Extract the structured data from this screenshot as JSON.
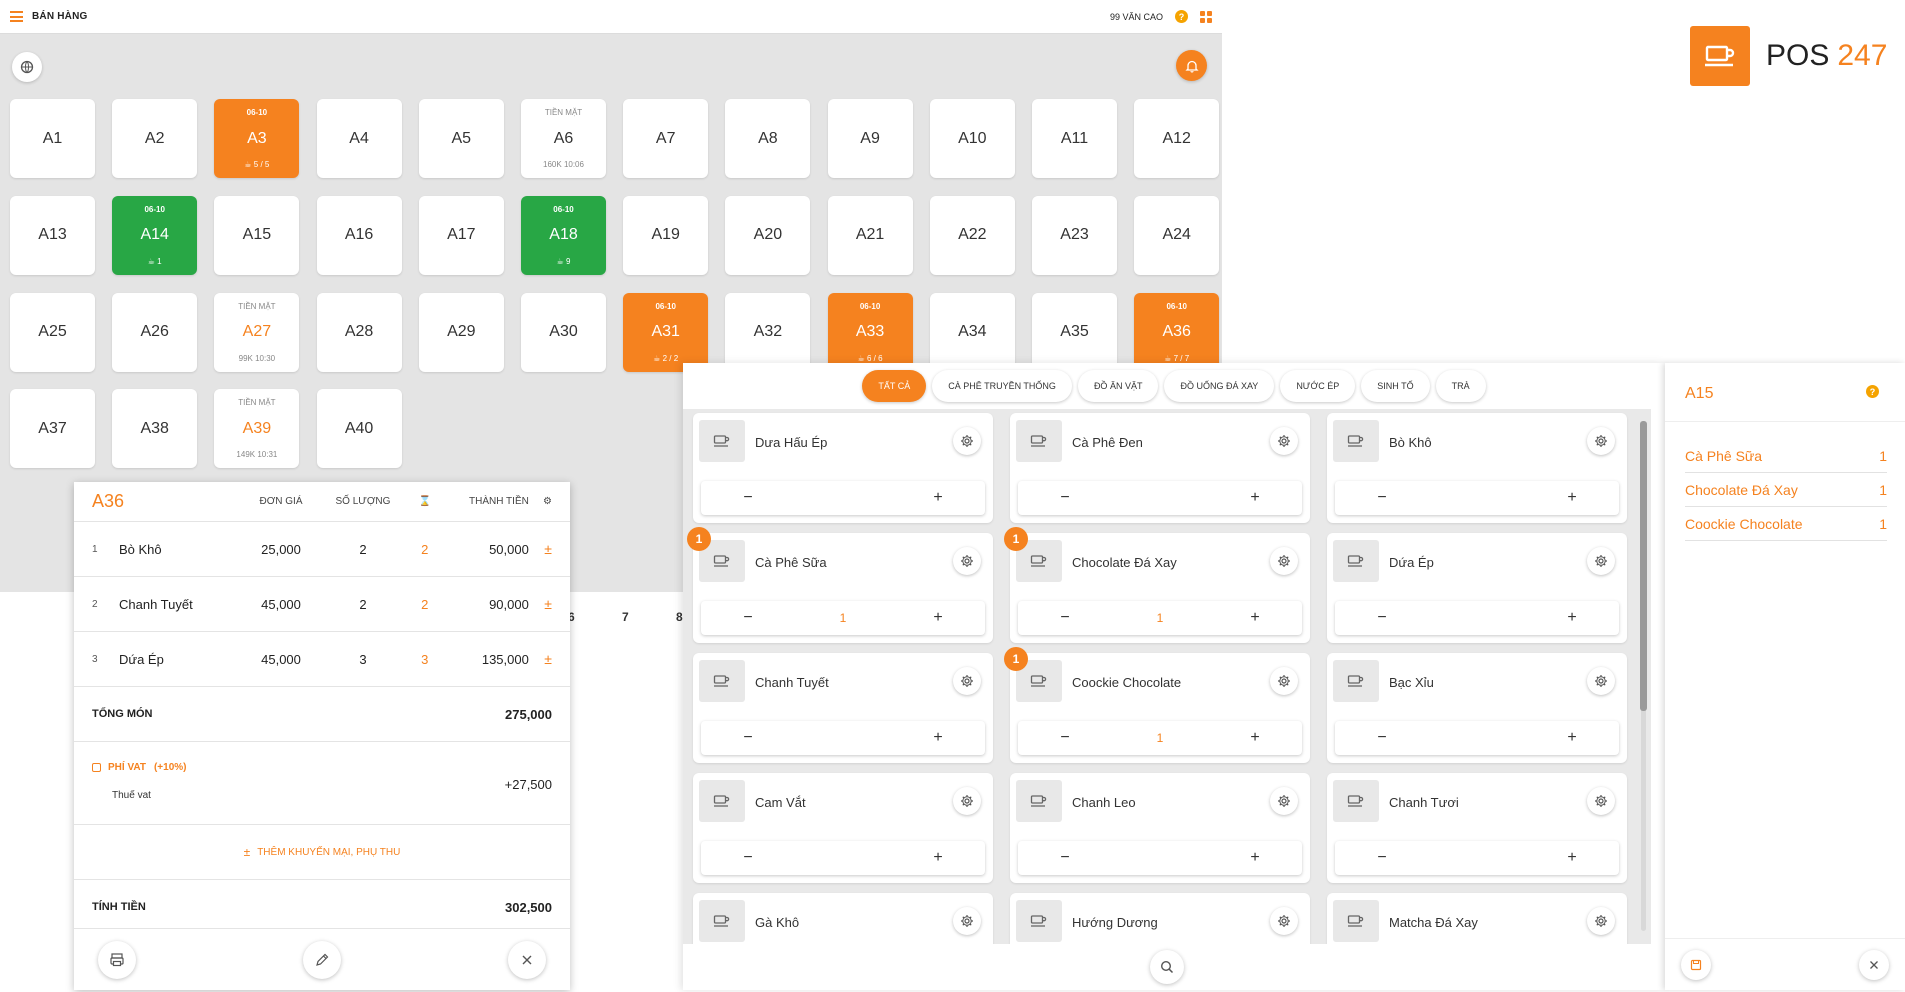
{
  "header": {
    "title": "BÁN HÀNG",
    "store": "99 VĂN CAO",
    "help": "?"
  },
  "tables": [
    {
      "name": "A1",
      "style": "plain",
      "top": "",
      "bottom": ""
    },
    {
      "name": "A2",
      "style": "plain",
      "top": "",
      "bottom": ""
    },
    {
      "name": "A3",
      "style": "orange",
      "top": "06-10",
      "bottom": "5 / 5"
    },
    {
      "name": "A4",
      "style": "plain",
      "top": "",
      "bottom": ""
    },
    {
      "name": "A5",
      "style": "plain",
      "top": "",
      "bottom": ""
    },
    {
      "name": "A6",
      "style": "plain",
      "top": "TIỀN MẶT",
      "bottom": "160K 10:06"
    },
    {
      "name": "A7",
      "style": "plain",
      "top": "",
      "bottom": ""
    },
    {
      "name": "A8",
      "style": "plain",
      "top": "",
      "bottom": ""
    },
    {
      "name": "A9",
      "style": "plain",
      "top": "",
      "bottom": ""
    },
    {
      "name": "A10",
      "style": "plain",
      "top": "",
      "bottom": ""
    },
    {
      "name": "A11",
      "style": "plain",
      "top": "",
      "bottom": ""
    },
    {
      "name": "A12",
      "style": "plain",
      "top": "",
      "bottom": ""
    },
    {
      "name": "A13",
      "style": "plain",
      "top": "",
      "bottom": ""
    },
    {
      "name": "A14",
      "style": "green",
      "top": "06-10",
      "bottom": "1"
    },
    {
      "name": "A15",
      "style": "plain",
      "top": "",
      "bottom": ""
    },
    {
      "name": "A16",
      "style": "plain",
      "top": "",
      "bottom": ""
    },
    {
      "name": "A17",
      "style": "plain",
      "top": "",
      "bottom": ""
    },
    {
      "name": "A18",
      "style": "green",
      "top": "06-10",
      "bottom": "9"
    },
    {
      "name": "A19",
      "style": "plain",
      "top": "",
      "bottom": ""
    },
    {
      "name": "A20",
      "style": "plain",
      "top": "",
      "bottom": ""
    },
    {
      "name": "A21",
      "style": "plain",
      "top": "",
      "bottom": ""
    },
    {
      "name": "A22",
      "style": "plain",
      "top": "",
      "bottom": ""
    },
    {
      "name": "A23",
      "style": "plain",
      "top": "",
      "bottom": ""
    },
    {
      "name": "A24",
      "style": "plain",
      "top": "",
      "bottom": ""
    },
    {
      "name": "A25",
      "style": "plain",
      "top": "",
      "bottom": ""
    },
    {
      "name": "A26",
      "style": "plain",
      "top": "",
      "bottom": ""
    },
    {
      "name": "A27",
      "style": "cash",
      "top": "TIỀN MẶT",
      "bottom": "99K 10:30"
    },
    {
      "name": "A28",
      "style": "plain",
      "top": "",
      "bottom": ""
    },
    {
      "name": "A29",
      "style": "plain",
      "top": "",
      "bottom": ""
    },
    {
      "name": "A30",
      "style": "plain",
      "top": "",
      "bottom": ""
    },
    {
      "name": "A31",
      "style": "orange",
      "top": "06-10",
      "bottom": "2 / 2"
    },
    {
      "name": "A32",
      "style": "plain",
      "top": "",
      "bottom": ""
    },
    {
      "name": "A33",
      "style": "orange",
      "top": "06-10",
      "bottom": "6 / 6"
    },
    {
      "name": "A34",
      "style": "plain",
      "top": "",
      "bottom": ""
    },
    {
      "name": "A35",
      "style": "plain",
      "top": "",
      "bottom": ""
    },
    {
      "name": "A36",
      "style": "orange",
      "top": "06-10",
      "bottom": "7 / 7"
    },
    {
      "name": "A37",
      "style": "plain",
      "top": "",
      "bottom": ""
    },
    {
      "name": "A38",
      "style": "plain",
      "top": "",
      "bottom": ""
    },
    {
      "name": "A39",
      "style": "cash",
      "top": "TIỀN MẶT",
      "bottom": "149K 10:31"
    },
    {
      "name": "A40",
      "style": "plain",
      "top": "",
      "bottom": ""
    }
  ],
  "stray_numbers": {
    "six": "6",
    "seven": "7",
    "eight": "8"
  },
  "order": {
    "table": "A36",
    "headers": {
      "price": "ĐƠN GIÁ",
      "qty": "SỐ LƯỢNG",
      "total": "THÀNH TIỀN"
    },
    "items": [
      {
        "idx": "1",
        "name": "Bò Khô",
        "price": "25,000",
        "qty": "2",
        "qty2": "2",
        "total": "50,000"
      },
      {
        "idx": "2",
        "name": "Chanh Tuyết",
        "price": "45,000",
        "qty": "2",
        "qty2": "2",
        "total": "90,000"
      },
      {
        "idx": "3",
        "name": "Dứa Ép",
        "price": "45,000",
        "qty": "3",
        "qty2": "3",
        "total": "135,000"
      }
    ],
    "subtotal_label": "TỔNG MÓN",
    "subtotal": "275,000",
    "vat_label": "PHÍ VAT",
    "vat_pct": "(+10%)",
    "vat_desc": "Thuế vat",
    "vat_value": "+27,500",
    "promo_label": "THÊM KHUYẾN MẠI, PHỤ THU",
    "pay_label": "TÍNH TIỀN",
    "pay_total": "302,500"
  },
  "categories": [
    {
      "label": "TẤT CẢ",
      "active": true
    },
    {
      "label": "CÀ PHÊ TRUYỀN THỐNG",
      "active": false
    },
    {
      "label": "ĐỒ ĂN VẶT",
      "active": false
    },
    {
      "label": "ĐỒ UỐNG ĐÁ XAY",
      "active": false
    },
    {
      "label": "NƯỚC ÉP",
      "active": false
    },
    {
      "label": "SINH TỐ",
      "active": false
    },
    {
      "label": "TRÀ",
      "active": false
    }
  ],
  "products": [
    {
      "name": "Dưa Hấu Ép",
      "qty": "",
      "badge": ""
    },
    {
      "name": "Cà Phê Đen",
      "qty": "",
      "badge": ""
    },
    {
      "name": "Bò Khô",
      "qty": "",
      "badge": ""
    },
    {
      "name": "Cà Phê Sữa",
      "qty": "1",
      "badge": "1"
    },
    {
      "name": "Chocolate Đá Xay",
      "qty": "1",
      "badge": "1"
    },
    {
      "name": "Dứa Ép",
      "qty": "",
      "badge": ""
    },
    {
      "name": "Chanh Tuyết",
      "qty": "",
      "badge": ""
    },
    {
      "name": "Coockie Chocolate",
      "qty": "1",
      "badge": "1"
    },
    {
      "name": "Bạc Xỉu",
      "qty": "",
      "badge": ""
    },
    {
      "name": "Cam Vắt",
      "qty": "",
      "badge": ""
    },
    {
      "name": "Chanh Leo",
      "qty": "",
      "badge": ""
    },
    {
      "name": "Chanh Tươi",
      "qty": "",
      "badge": ""
    },
    {
      "name": "Gà Khô",
      "qty": "",
      "badge": ""
    },
    {
      "name": "Hướng Dương",
      "qty": "",
      "badge": ""
    },
    {
      "name": "Matcha Đá Xay",
      "qty": "",
      "badge": ""
    }
  ],
  "stepper": {
    "minus": "−",
    "plus": "+"
  },
  "cart": {
    "table": "A15",
    "help": "?",
    "items": [
      {
        "name": "Cà Phê Sữa",
        "qty": "1"
      },
      {
        "name": "Chocolate Đá Xay",
        "qty": "1"
      },
      {
        "name": "Coockie Chocolate",
        "qty": "1"
      }
    ]
  },
  "logo": {
    "word": "POS",
    "number": "247"
  },
  "colors": {
    "accent": "#f5821f",
    "green": "#28a745"
  }
}
